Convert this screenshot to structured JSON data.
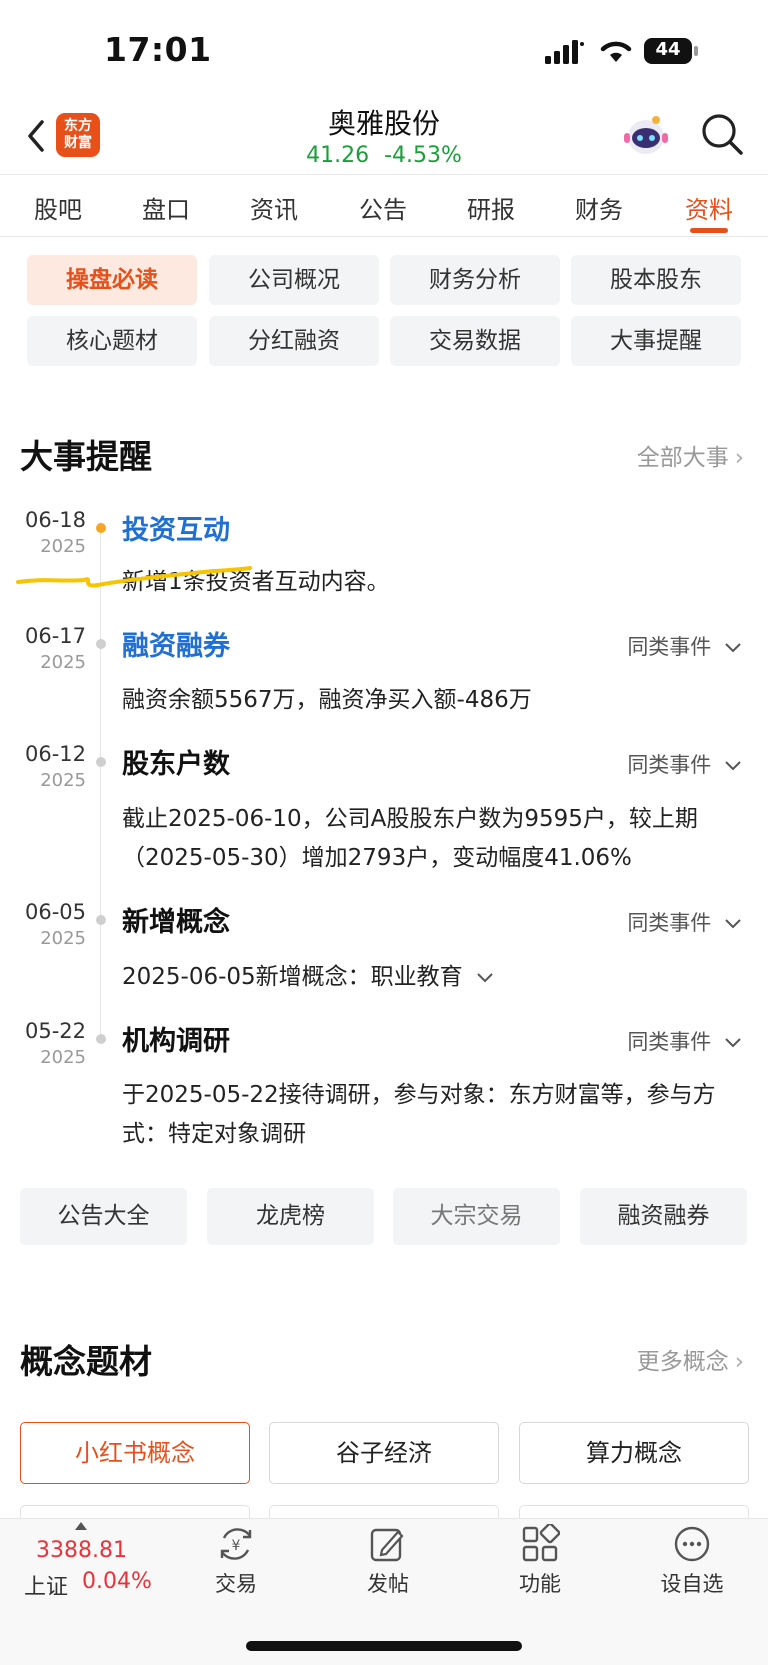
{
  "status_bar": {
    "time": "17:01",
    "battery": "44"
  },
  "header": {
    "logo_text": "东方财富",
    "stock_name": "奥雅股份",
    "price": "41.26",
    "change_pct": "-4.53%"
  },
  "tabs": [
    {
      "label": "股吧"
    },
    {
      "label": "盘口"
    },
    {
      "label": "资讯"
    },
    {
      "label": "公告"
    },
    {
      "label": "研报"
    },
    {
      "label": "财务"
    },
    {
      "label": "资料",
      "active": true
    }
  ],
  "submenu": [
    {
      "label": "操盘必读",
      "active": true
    },
    {
      "label": "公司概况"
    },
    {
      "label": "财务分析"
    },
    {
      "label": "股本股东"
    },
    {
      "label": "核心题材"
    },
    {
      "label": "分红融资"
    },
    {
      "label": "交易数据"
    },
    {
      "label": "大事提醒"
    }
  ],
  "events_section": {
    "title": "大事提醒",
    "link": "全部大事",
    "events": [
      {
        "date": "06-18",
        "year": "2025",
        "title": "投资互动",
        "desc": "新增1条投资者互动内容。",
        "more": ""
      },
      {
        "date": "06-17",
        "year": "2025",
        "title": "融资融券",
        "desc": "融资余额5567万，融资净买入额-486万",
        "more": "同类事件"
      },
      {
        "date": "06-12",
        "year": "2025",
        "title": "股东户数",
        "desc": "截止2025-06-10，公司A股股东户数为9595户，较上期（2025-05-30）增加2793户，变动幅度41.06%",
        "more": "同类事件"
      },
      {
        "date": "06-05",
        "year": "2025",
        "title": "新增概念",
        "desc": "2025-06-05新增概念：职业教育",
        "more": "同类事件"
      },
      {
        "date": "05-22",
        "year": "2025",
        "title": "机构调研",
        "desc": "于2025-05-22接待调研，参与对象：东方财富等，参与方式：特定对象调研",
        "more": "同类事件"
      }
    ]
  },
  "quick_buttons": [
    {
      "label": "公告大全"
    },
    {
      "label": "龙虎榜"
    },
    {
      "label": "大宗交易"
    },
    {
      "label": "融资融券"
    }
  ],
  "concepts_section": {
    "title": "概念题材",
    "link": "更多概念",
    "chips": [
      {
        "label": "小红书概念",
        "active": true
      },
      {
        "label": "谷子经济"
      },
      {
        "label": "算力概念"
      }
    ]
  },
  "bottom_bar": {
    "index_value": "3388.81",
    "index_name": "上证",
    "index_change": "0.04%",
    "items": [
      {
        "label": "交易",
        "icon": "trade-icon"
      },
      {
        "label": "发帖",
        "icon": "post-icon"
      },
      {
        "label": "功能",
        "icon": "grid-icon"
      },
      {
        "label": "设自选",
        "icon": "more-icon"
      }
    ]
  },
  "colors": {
    "accent": "#e8501a",
    "down": "#1aa038",
    "up": "#e8333a",
    "link_blue": "#1f6fd4"
  }
}
